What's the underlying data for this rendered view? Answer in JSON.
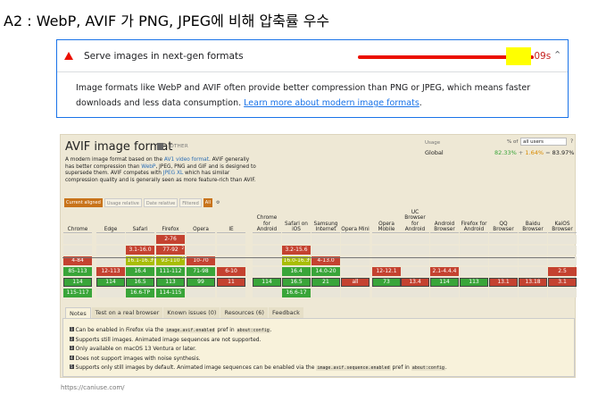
{
  "slide_title": "A2 : WebP, AVIF 가 PNG, JPEG에 비해 압축률 우수",
  "lighthouse": {
    "audit_title": "Serve images in next-gen formats",
    "savings_value": ".09s",
    "description": "Image formats like WebP and AVIF often provide better compression than PNG or JPEG, which means faster downloads and less data consumption. ",
    "link_text": "Learn more about modern image formats",
    "link_suffix": ".",
    "colors": {
      "fail": "#eb0f00",
      "link": "#1a73e8",
      "highlight": "#ffff00"
    }
  },
  "caniuse": {
    "title": "AVIF image format",
    "category": "- OTHER",
    "desc_1": "A modern image format based on the ",
    "desc_link_1": "AV1 video format",
    "desc_2": ". AVIF generally has better compression than ",
    "desc_link_2": "WebP",
    "desc_3": ", JPEG, PNG and GIF and is designed to supersede them. AVIF competes with ",
    "desc_link_3": "JPEG XL",
    "desc_4": " which has similar compression quality and is generally seen as more feature-rich than AVIF.",
    "usage_label": "Usage",
    "pct_of_label": "% of",
    "user_select": "all users",
    "help_icon": "?",
    "global_label": "Global",
    "global_supported": "82.33%",
    "plus": "+",
    "global_partial": "1.64%",
    "equals": "=",
    "global_total": "83.97%",
    "filters": [
      "Current aligned",
      "Usage relative",
      "Date relative",
      "Filtered",
      "All"
    ],
    "browsers": [
      "Chrome",
      "Edge",
      "Safari",
      "Firefox",
      "Opera",
      "IE",
      "Chrome for Android",
      "Safari on iOS",
      "Samsung Internet",
      "Opera Mini",
      "Opera Mobile",
      "UC Browser for Android",
      "Android Browser",
      "Firefox for Android",
      "QQ Browser",
      "Baidu Browser",
      "KaiOS Browser"
    ],
    "cells": [
      {
        "b": 3,
        "r": 0,
        "t": "2-76",
        "s": "n"
      },
      {
        "b": 2,
        "r": 1,
        "t": "3.1-16.0",
        "s": "n"
      },
      {
        "b": 3,
        "r": 1,
        "t": "77-92",
        "s": "n",
        "n": "2"
      },
      {
        "b": 7,
        "r": 1,
        "t": "3.2-15.6",
        "s": "n"
      },
      {
        "b": 0,
        "r": 2,
        "t": "4-84",
        "s": "n"
      },
      {
        "b": 2,
        "r": 2,
        "t": "16.1-16.3",
        "s": "p",
        "n": "4"
      },
      {
        "b": 3,
        "r": 2,
        "t": "93-110",
        "s": "p",
        "n": "5"
      },
      {
        "b": 4,
        "r": 2,
        "t": "10-70",
        "s": "n"
      },
      {
        "b": 7,
        "r": 2,
        "t": "16.0-16.3",
        "s": "p",
        "n": "4"
      },
      {
        "b": 8,
        "r": 2,
        "t": "4-13.0",
        "s": "n"
      },
      {
        "b": 0,
        "r": 3,
        "t": "85-113",
        "s": "y"
      },
      {
        "b": 1,
        "r": 3,
        "t": "12-113",
        "s": "n"
      },
      {
        "b": 2,
        "r": 3,
        "t": "16.4",
        "s": "y"
      },
      {
        "b": 3,
        "r": 3,
        "t": "111-112",
        "s": "y"
      },
      {
        "b": 4,
        "r": 3,
        "t": "71-98",
        "s": "y"
      },
      {
        "b": 5,
        "r": 3,
        "t": "6-10",
        "s": "n"
      },
      {
        "b": 7,
        "r": 3,
        "t": "16.4",
        "s": "y"
      },
      {
        "b": 8,
        "r": 3,
        "t": "14.0-20",
        "s": "y"
      },
      {
        "b": 10,
        "r": 3,
        "t": "12-12.1",
        "s": "n"
      },
      {
        "b": 12,
        "r": 3,
        "t": "2.1-4.4.4",
        "s": "n"
      },
      {
        "b": 16,
        "r": 3,
        "t": "2.5",
        "s": "n"
      },
      {
        "b": 0,
        "r": 4,
        "t": "114",
        "s": "y",
        "c": true
      },
      {
        "b": 1,
        "r": 4,
        "t": "114",
        "s": "y",
        "c": true
      },
      {
        "b": 2,
        "r": 4,
        "t": "16.5",
        "s": "y",
        "c": true
      },
      {
        "b": 3,
        "r": 4,
        "t": "113",
        "s": "y",
        "c": true
      },
      {
        "b": 4,
        "r": 4,
        "t": "99",
        "s": "y",
        "c": true
      },
      {
        "b": 5,
        "r": 4,
        "t": "11",
        "s": "n",
        "c": true
      },
      {
        "b": 6,
        "r": 4,
        "t": "114",
        "s": "y",
        "c": true
      },
      {
        "b": 7,
        "r": 4,
        "t": "16.5",
        "s": "y",
        "c": true
      },
      {
        "b": 8,
        "r": 4,
        "t": "21",
        "s": "y",
        "c": true
      },
      {
        "b": 9,
        "r": 4,
        "t": "all",
        "s": "n",
        "c": true
      },
      {
        "b": 10,
        "r": 4,
        "t": "73",
        "s": "y",
        "c": true
      },
      {
        "b": 11,
        "r": 4,
        "t": "13.4",
        "s": "n",
        "c": true
      },
      {
        "b": 12,
        "r": 4,
        "t": "114",
        "s": "y",
        "c": true
      },
      {
        "b": 13,
        "r": 4,
        "t": "113",
        "s": "y",
        "c": true
      },
      {
        "b": 14,
        "r": 4,
        "t": "13.1",
        "s": "n",
        "c": true
      },
      {
        "b": 15,
        "r": 4,
        "t": "13.18",
        "s": "n",
        "c": true
      },
      {
        "b": 16,
        "r": 4,
        "t": "3.1",
        "s": "n",
        "c": true
      },
      {
        "b": 0,
        "r": 5,
        "t": "115-117",
        "s": "y"
      },
      {
        "b": 2,
        "r": 5,
        "t": "16.6-TP",
        "s": "y"
      },
      {
        "b": 3,
        "r": 5,
        "t": "114-115",
        "s": "y"
      },
      {
        "b": 7,
        "r": 5,
        "t": "16.6-17",
        "s": "y"
      }
    ],
    "tabs": [
      "Notes",
      "Test on a real browser",
      "Known issues (0)",
      "Resources (6)",
      "Feedback"
    ],
    "notes": [
      {
        "n": "1",
        "parts": [
          [
            "t",
            "Can be enabled in Firefox via the "
          ],
          [
            "c",
            "image.avif.enabled"
          ],
          [
            "t",
            " pref in "
          ],
          [
            "c",
            "about:config"
          ],
          [
            "t",
            "."
          ]
        ]
      },
      {
        "n": "2",
        "parts": [
          [
            "t",
            "Supports still images. Animated image sequences are not supported."
          ]
        ]
      },
      {
        "n": "3",
        "parts": [
          [
            "t",
            "Only available on macOS 13 Ventura or later."
          ]
        ]
      },
      {
        "n": "4",
        "parts": [
          [
            "t",
            "Does not support images with noise synthesis."
          ]
        ]
      },
      {
        "n": "5",
        "parts": [
          [
            "t",
            "Supports only still images by default. Animated image sequences can be enabled via the "
          ],
          [
            "c",
            "image.avif.sequence.enabled"
          ],
          [
            "t",
            " pref in "
          ],
          [
            "c",
            "about:config"
          ],
          [
            "t",
            "."
          ]
        ]
      }
    ],
    "colors": {
      "supported": "#39a539",
      "unsupported": "#c44230",
      "partial": "#a8bd04",
      "panel": "#eee8d5"
    }
  },
  "source_url": "https://caniuse.com/"
}
